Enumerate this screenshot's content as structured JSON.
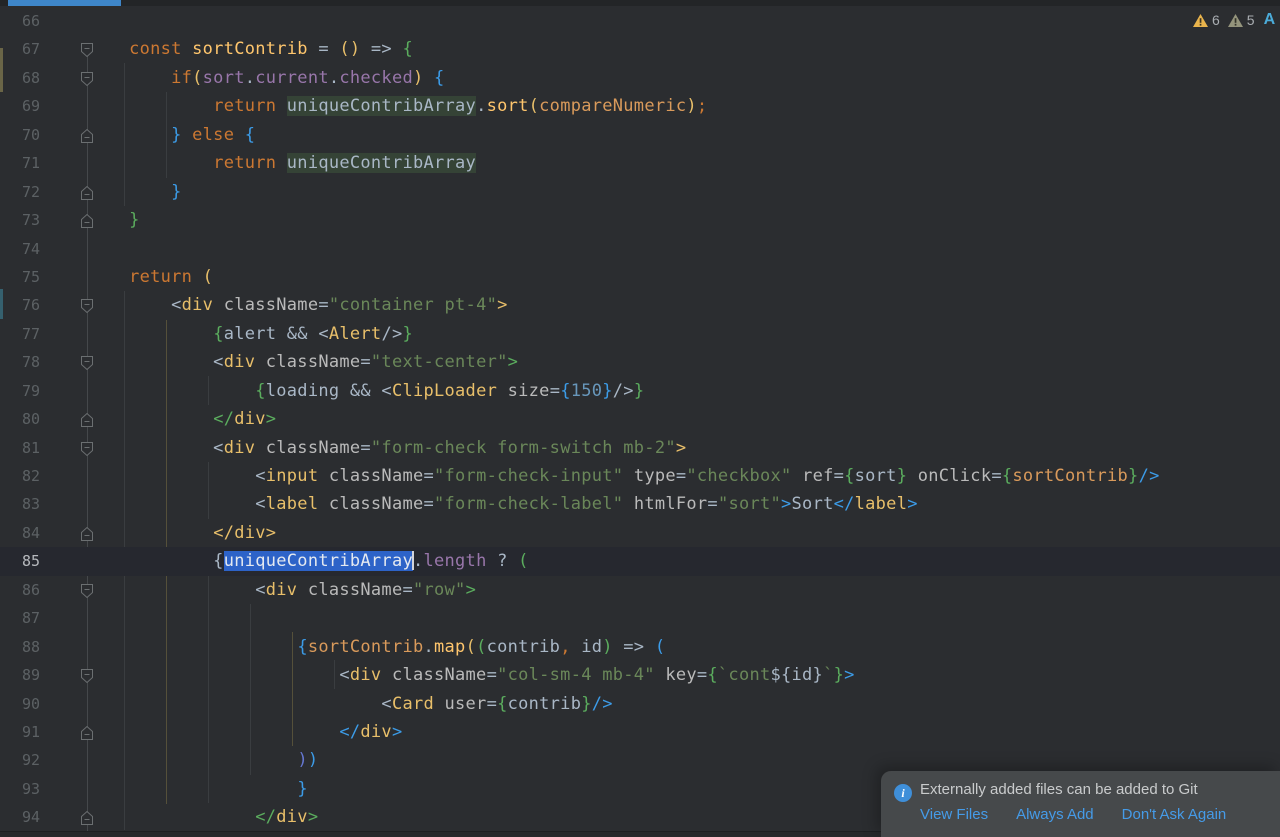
{
  "colors": {
    "accent": "#3E86C9",
    "selection": "#2D63C8",
    "link": "#459BE8",
    "info": "#3F8FD9",
    "warning": "#E9B44C",
    "weak_warning": "#94947C"
  },
  "inspections": {
    "warning_count": "6",
    "weak_warning_count": "5",
    "extra_badge": "A"
  },
  "notification": {
    "message": "Externally added files can be added to Git",
    "actions": [
      {
        "label": "View Files"
      },
      {
        "label": "Always Add"
      },
      {
        "label": "Don't Ask Again"
      }
    ]
  },
  "code": {
    "lines": [
      {
        "n": 66,
        "fold": null,
        "tokens": []
      },
      {
        "n": 67,
        "fold": "down",
        "tokens": [
          [
            "pc",
            "    "
          ],
          [
            "kw",
            "const "
          ],
          [
            "fn",
            "sortContrib"
          ],
          [
            "pc",
            " = "
          ],
          [
            "by",
            "()"
          ],
          [
            "pc",
            " => "
          ],
          [
            "bg2",
            "{"
          ]
        ]
      },
      {
        "n": 68,
        "fold": "down",
        "tokens": [
          [
            "pc",
            "        "
          ],
          [
            "kw",
            "if"
          ],
          [
            "by",
            "("
          ],
          [
            "pr",
            "sort"
          ],
          [
            "pc",
            "."
          ],
          [
            "pr",
            "current"
          ],
          [
            "pc",
            "."
          ],
          [
            "pr",
            "checked"
          ],
          [
            "by",
            ")"
          ],
          [
            "pc",
            " "
          ],
          [
            "bb",
            "{"
          ]
        ]
      },
      {
        "n": 69,
        "fold": null,
        "tokens": [
          [
            "pc",
            "            "
          ],
          [
            "kw",
            "return "
          ],
          [
            "hl",
            "uniqueContribArray"
          ],
          [
            "pc",
            "."
          ],
          [
            "fn",
            "sort"
          ],
          [
            "by",
            "("
          ],
          [
            "fnr",
            "compareNumeric"
          ],
          [
            "by",
            ")"
          ],
          [
            "cm",
            ";"
          ]
        ]
      },
      {
        "n": 70,
        "fold": "up",
        "tokens": [
          [
            "pc",
            "        "
          ],
          [
            "bb",
            "}"
          ],
          [
            "kw",
            " else "
          ],
          [
            "bb",
            "{"
          ]
        ]
      },
      {
        "n": 71,
        "fold": null,
        "tokens": [
          [
            "pc",
            "            "
          ],
          [
            "kw",
            "return "
          ],
          [
            "hl",
            "uniqueContribArray"
          ]
        ]
      },
      {
        "n": 72,
        "fold": "up",
        "tokens": [
          [
            "pc",
            "        "
          ],
          [
            "bb",
            "}"
          ]
        ]
      },
      {
        "n": 73,
        "fold": "up",
        "tokens": [
          [
            "pc",
            "    "
          ],
          [
            "bg2",
            "}"
          ]
        ]
      },
      {
        "n": 74,
        "fold": null,
        "tokens": []
      },
      {
        "n": 75,
        "fold": null,
        "tokens": [
          [
            "pc",
            "    "
          ],
          [
            "kw",
            "return "
          ],
          [
            "by",
            "("
          ]
        ]
      },
      {
        "n": 76,
        "fold": "down",
        "tokens": [
          [
            "pc",
            "        <"
          ],
          [
            "tag",
            "div"
          ],
          [
            "pc",
            " "
          ],
          [
            "at",
            "className"
          ],
          [
            "pc",
            "="
          ],
          [
            "st",
            "\"container pt-4\""
          ],
          [
            "by",
            ">"
          ]
        ]
      },
      {
        "n": 77,
        "fold": null,
        "tokens": [
          [
            "pc",
            "            "
          ],
          [
            "bg2",
            "{"
          ],
          [
            "pl",
            "alert"
          ],
          [
            "pc",
            " && <"
          ],
          [
            "tag",
            "Alert"
          ],
          [
            "pc",
            "/>"
          ],
          [
            "bg2",
            "}"
          ]
        ]
      },
      {
        "n": 78,
        "fold": "down",
        "tokens": [
          [
            "pc",
            "            <"
          ],
          [
            "tag",
            "div"
          ],
          [
            "pc",
            " "
          ],
          [
            "at",
            "className"
          ],
          [
            "pc",
            "="
          ],
          [
            "st",
            "\"text-center\""
          ],
          [
            "bg2",
            ">"
          ]
        ]
      },
      {
        "n": 79,
        "fold": null,
        "tokens": [
          [
            "pc",
            "                "
          ],
          [
            "bg2",
            "{"
          ],
          [
            "pl",
            "loading"
          ],
          [
            "pc",
            " && <"
          ],
          [
            "tag",
            "ClipLoader"
          ],
          [
            "pc",
            " "
          ],
          [
            "at",
            "size"
          ],
          [
            "pc",
            "="
          ],
          [
            "bb",
            "{"
          ],
          [
            "nm",
            "150"
          ],
          [
            "bb",
            "}"
          ],
          [
            "pc",
            "/>"
          ],
          [
            "bg2",
            "}"
          ]
        ]
      },
      {
        "n": 80,
        "fold": "up",
        "tokens": [
          [
            "pc",
            "            "
          ],
          [
            "bg2",
            "</"
          ],
          [
            "tag",
            "div"
          ],
          [
            "bg2",
            ">"
          ]
        ]
      },
      {
        "n": 81,
        "fold": "down",
        "tokens": [
          [
            "pc",
            "            <"
          ],
          [
            "tag",
            "div"
          ],
          [
            "pc",
            " "
          ],
          [
            "at",
            "className"
          ],
          [
            "pc",
            "="
          ],
          [
            "st",
            "\"form-check form-switch mb-2\""
          ],
          [
            "by",
            ">"
          ]
        ]
      },
      {
        "n": 82,
        "fold": null,
        "tokens": [
          [
            "pc",
            "                <"
          ],
          [
            "tag",
            "input"
          ],
          [
            "pc",
            " "
          ],
          [
            "at",
            "className"
          ],
          [
            "pc",
            "="
          ],
          [
            "st",
            "\"form-check-input\""
          ],
          [
            "pc",
            " "
          ],
          [
            "at",
            "type"
          ],
          [
            "pc",
            "="
          ],
          [
            "st",
            "\"checkbox\""
          ],
          [
            "pc",
            " "
          ],
          [
            "at",
            "ref"
          ],
          [
            "pc",
            "="
          ],
          [
            "bg2",
            "{"
          ],
          [
            "pl",
            "sort"
          ],
          [
            "bg2",
            "}"
          ],
          [
            "pc",
            " "
          ],
          [
            "at",
            "onClick"
          ],
          [
            "pc",
            "="
          ],
          [
            "bg2",
            "{"
          ],
          [
            "fnr",
            "sortContrib"
          ],
          [
            "bg2",
            "}"
          ],
          [
            "bb",
            "/>"
          ]
        ]
      },
      {
        "n": 83,
        "fold": null,
        "tokens": [
          [
            "pc",
            "                <"
          ],
          [
            "tag",
            "label"
          ],
          [
            "pc",
            " "
          ],
          [
            "at",
            "className"
          ],
          [
            "pc",
            "="
          ],
          [
            "st",
            "\"form-check-label\""
          ],
          [
            "pc",
            " "
          ],
          [
            "at",
            "htmlFor"
          ],
          [
            "pc",
            "="
          ],
          [
            "st",
            "\"sort\""
          ],
          [
            "bb",
            ">"
          ],
          [
            "pl",
            "Sort"
          ],
          [
            "bb",
            "</"
          ],
          [
            "tag",
            "label"
          ],
          [
            "bb",
            ">"
          ]
        ]
      },
      {
        "n": 84,
        "fold": "up",
        "tokens": [
          [
            "pc",
            "            "
          ],
          [
            "by",
            "</"
          ],
          [
            "tag",
            "div"
          ],
          [
            "by",
            ">"
          ]
        ]
      },
      {
        "n": 85,
        "fold": null,
        "caret_row": true,
        "tokens": [
          [
            "pc",
            "            {"
          ],
          [
            "sel",
            "uniqueContribArray"
          ],
          [
            "caret",
            ""
          ],
          [
            "pc",
            "."
          ],
          [
            "pr",
            "length"
          ],
          [
            "pc",
            " ? "
          ],
          [
            "bg2",
            "("
          ]
        ]
      },
      {
        "n": 86,
        "fold": "down",
        "tokens": [
          [
            "pc",
            "                <"
          ],
          [
            "tag",
            "div"
          ],
          [
            "pc",
            " "
          ],
          [
            "at",
            "className"
          ],
          [
            "pc",
            "="
          ],
          [
            "st",
            "\"row\""
          ],
          [
            "bg2",
            ">"
          ]
        ]
      },
      {
        "n": 87,
        "fold": null,
        "tokens": []
      },
      {
        "n": 88,
        "fold": null,
        "tokens": [
          [
            "pc",
            "                    "
          ],
          [
            "bb",
            "{"
          ],
          [
            "fnr",
            "sortContrib"
          ],
          [
            "pc",
            "."
          ],
          [
            "fn",
            "map"
          ],
          [
            "by",
            "("
          ],
          [
            "bg2",
            "("
          ],
          [
            "pl",
            "contrib"
          ],
          [
            "cm",
            ","
          ],
          [
            "pl",
            " id"
          ],
          [
            "bg2",
            ")"
          ],
          [
            "pc",
            " => "
          ],
          [
            "bb",
            "("
          ]
        ]
      },
      {
        "n": 89,
        "fold": "down",
        "tokens": [
          [
            "pc",
            "                        <"
          ],
          [
            "tag",
            "div"
          ],
          [
            "pc",
            " "
          ],
          [
            "at",
            "className"
          ],
          [
            "pc",
            "="
          ],
          [
            "st",
            "\"col-sm-4 mb-4\""
          ],
          [
            "pc",
            " "
          ],
          [
            "at",
            "key"
          ],
          [
            "pc",
            "="
          ],
          [
            "bg2",
            "{"
          ],
          [
            "st",
            "`cont"
          ],
          [
            "pl",
            "${id}"
          ],
          [
            "st",
            "`"
          ],
          [
            "bg2",
            "}"
          ],
          [
            "bb",
            ">"
          ]
        ]
      },
      {
        "n": 90,
        "fold": null,
        "tokens": [
          [
            "pc",
            "                            <"
          ],
          [
            "tag",
            "Card"
          ],
          [
            "pc",
            " "
          ],
          [
            "at",
            "user"
          ],
          [
            "pc",
            "="
          ],
          [
            "bg2",
            "{"
          ],
          [
            "pl",
            "contrib"
          ],
          [
            "bg2",
            "}"
          ],
          [
            "bb",
            "/>"
          ]
        ]
      },
      {
        "n": 91,
        "fold": "up",
        "tokens": [
          [
            "pc",
            "                        "
          ],
          [
            "bb",
            "</"
          ],
          [
            "tag",
            "div"
          ],
          [
            "bb",
            ">"
          ]
        ]
      },
      {
        "n": 92,
        "fold": null,
        "tokens": [
          [
            "pc",
            "                    "
          ],
          [
            "bi",
            ")"
          ],
          [
            "bb",
            ")"
          ]
        ]
      },
      {
        "n": 93,
        "fold": null,
        "tokens": [
          [
            "pc",
            "                    "
          ],
          [
            "bb",
            "}"
          ]
        ]
      },
      {
        "n": 94,
        "fold": "up",
        "tokens": [
          [
            "pc",
            "                "
          ],
          [
            "bg2",
            "</"
          ],
          [
            "tag",
            "div"
          ],
          [
            "bg2",
            ">"
          ]
        ]
      }
    ]
  }
}
